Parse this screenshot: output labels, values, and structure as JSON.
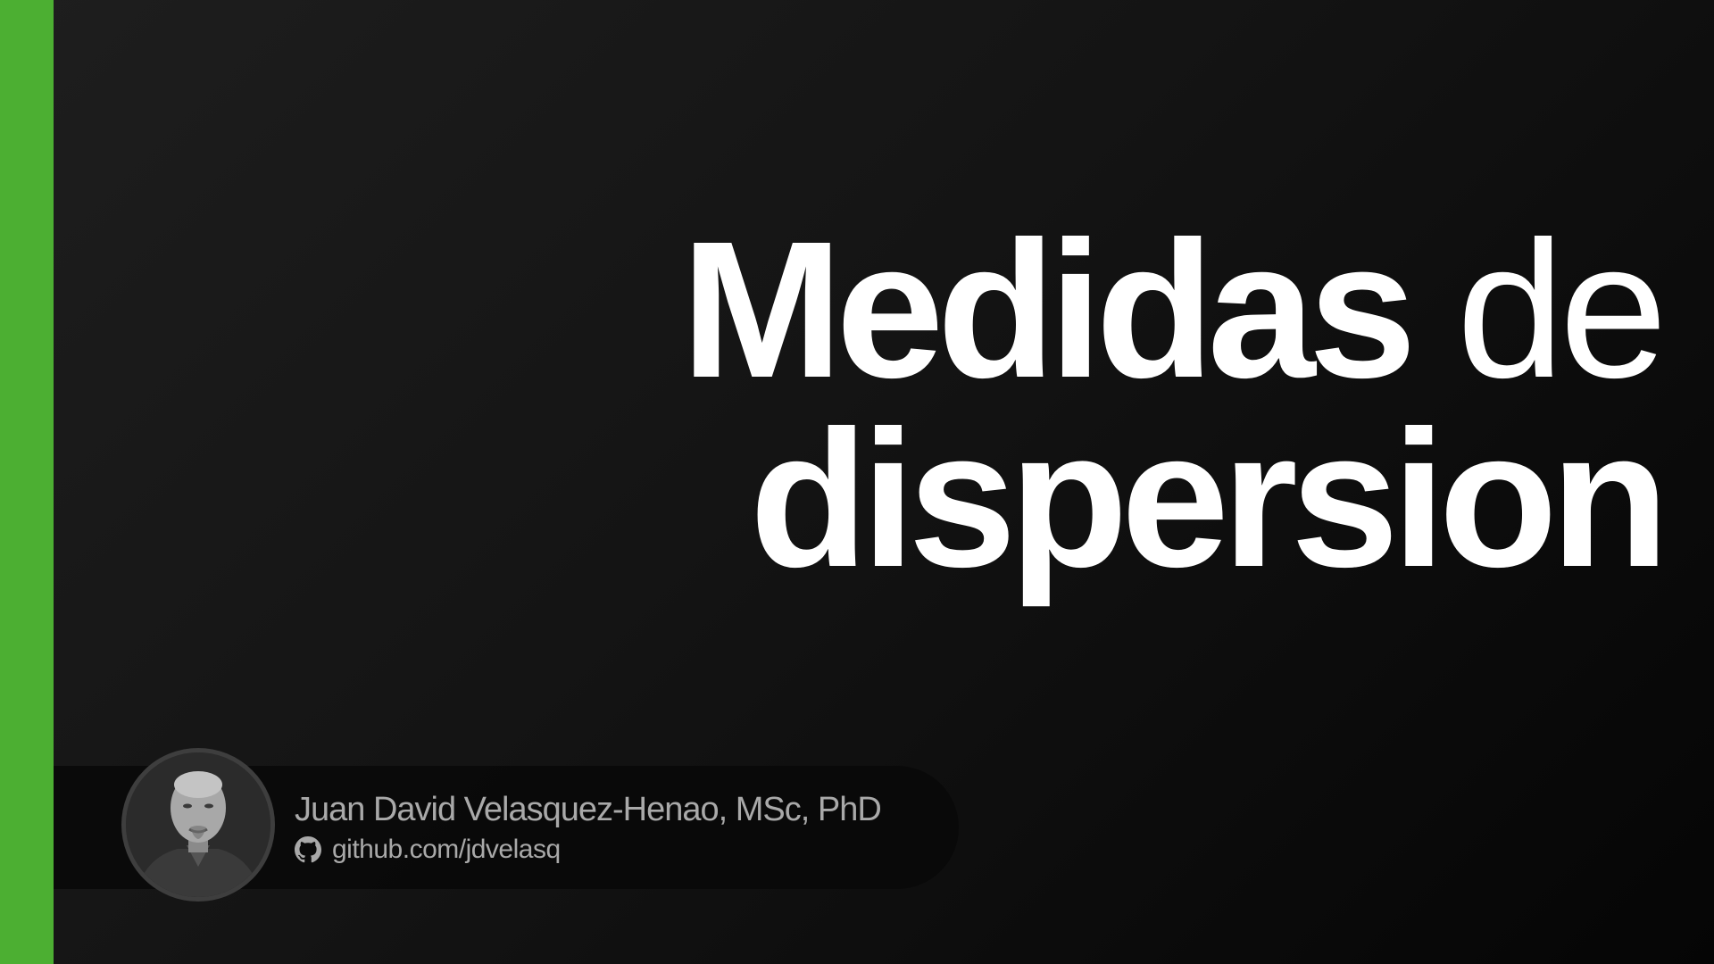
{
  "slide": {
    "title_word1": "Medidas",
    "title_word2": "de",
    "title_word3": "dispersion"
  },
  "author": {
    "name": "Juan David Velasquez-Henao, MSc, PhD",
    "link_text": "github.com/jdvelasq",
    "link_icon": "github-icon",
    "avatar_icon": "avatar-photo"
  },
  "colors": {
    "accent": "#4caf32",
    "background": "#141414",
    "title": "#ffffff",
    "author_text": "#a9a9a9"
  }
}
